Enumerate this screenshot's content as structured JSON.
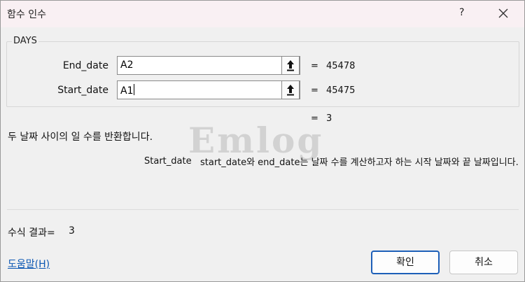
{
  "window": {
    "title": "함수 인수",
    "help_glyph": "?",
    "close_icon": "close-icon"
  },
  "function": {
    "name": "DAYS"
  },
  "args": [
    {
      "label": "End_date",
      "value": "A2",
      "eq": "=",
      "result": "45478"
    },
    {
      "label": "Start_date",
      "value": "A1",
      "eq": "=",
      "result": "45475"
    }
  ],
  "result": {
    "eq": "=",
    "value": "3"
  },
  "description": "두 날짜 사이의 일 수를 반환합니다.",
  "watermark": "Emlog",
  "param_help": {
    "name": "Start_date",
    "text": "start_date와 end_date는 날짜 수를 계산하고자 하는 시작 날짜와 끝 날짜입니다."
  },
  "formula_result": {
    "label": "수식 결과=",
    "value": "3"
  },
  "help_link": "도움말(H)",
  "buttons": {
    "ok": "확인",
    "cancel": "취소"
  },
  "colors": {
    "titlebar": "#f9f0f3",
    "accent": "#1d5fb8",
    "link": "#0b57b3"
  }
}
